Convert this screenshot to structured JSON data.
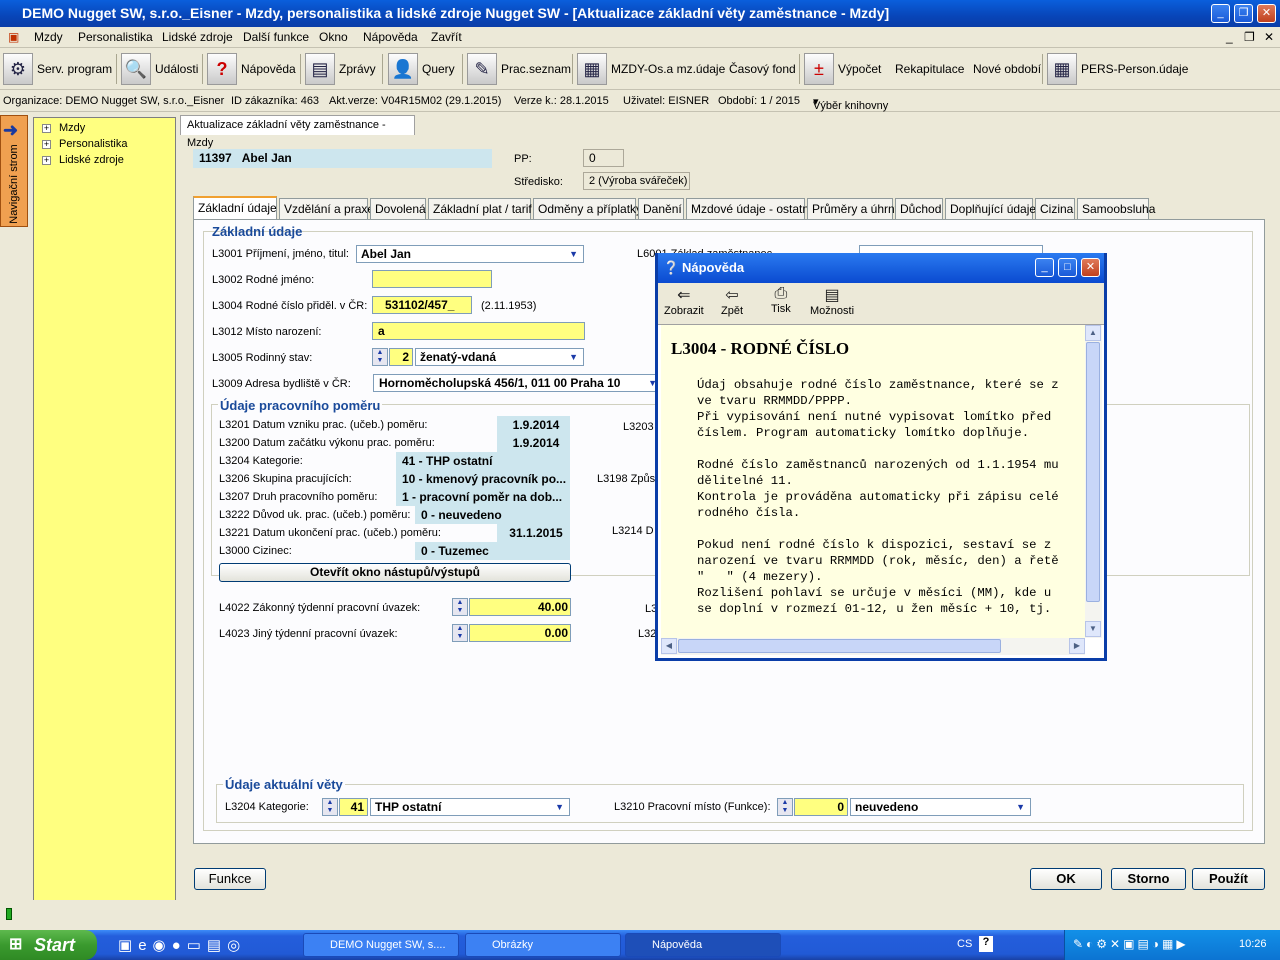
{
  "window": {
    "title": "DEMO Nugget SW, s.r.o._Eisner - Mzdy, personalistika a lidské zdroje Nugget SW - [Aktualizace základní věty zaměstnance - Mzdy]"
  },
  "menu": [
    "Mzdy",
    "Personalistika",
    "Lidské zdroje",
    "Další funkce",
    "Okno",
    "Nápověda",
    "Zavřít"
  ],
  "toolbar": [
    "Serv. program",
    "Události",
    "Nápověda",
    "Zprávy",
    "Query",
    "Prac.seznam",
    "MZDY-Os.a mz.údaje",
    "Časový fond",
    "Výpočet",
    "Rekapitulace",
    "Nové období",
    "PERS-Person.údaje"
  ],
  "info": {
    "org": "Organizace: DEMO Nugget SW, s.r.o._Eisner",
    "cid": "ID zákazníka: 463",
    "ver": "Akt.verze: V04R15M02 (29.1.2015)",
    "verk": "Verze k.: 28.1.2015",
    "user": "Uživatel: EISNER",
    "period": "Období: 1 / 2015",
    "lib": "Výběr knihovny"
  },
  "nav": {
    "strip": "Navigační strom",
    "items": [
      "Mzdy",
      "Personalistika",
      "Lidské zdroje"
    ]
  },
  "doc": {
    "tab": "Aktualizace základní věty zaměstnance - Mzdy"
  },
  "employee": {
    "id": "11397",
    "name": "Abel Jan",
    "pp_label": "PP:",
    "pp": "0",
    "stredisko_label": "Středisko:",
    "stredisko": "2 (Výroba svářeček)"
  },
  "tabs": [
    "Základní údaje",
    "Vzdělání a praxe",
    "Dovolená",
    "Základní plat / tarif",
    "Odměny a příplatky",
    "Danění",
    "Mzdové údaje - ostatní",
    "Průměry a úhrny",
    "Důchod",
    "Doplňující údaje",
    "Cizina",
    "Samoobsluha"
  ],
  "basic": {
    "section": "Základní údaje",
    "l3001": "L3001 Příjmení, jméno, titul:",
    "l3001_v": "Abel Jan",
    "l3002": "L3002 Rodné jméno:",
    "l3004": "L3004 Rodné číslo přiděl. v ČR:",
    "l3004_v": "531102/457_",
    "l3004_d": "(2.11.1953)",
    "l3012": "L3012 Místo narození:",
    "l3012_v": "a",
    "l3005": "L3005 Rodinný stav:",
    "l3005_n": "2",
    "l3005_v": "ženatý-vdaná",
    "l3009": "L3009 Adresa bydliště v ČR:",
    "l3009_v": "Hornoměcholupská 456/1, 011 00  Praha 10",
    "l6001": "L6001 Základ zaměstnanec"
  },
  "work": {
    "section": "Údaje pracovního poměru",
    "l3201": "L3201 Datum vzniku prac. (učeb.) poměru:",
    "l3201_v": "1.9.2014",
    "l3200": "L3200 Datum začátku výkonu prac. poměru:",
    "l3200_v": "1.9.2014",
    "l3204": "L3204 Kategorie:",
    "l3204_v": "41 - THP ostatní",
    "l3206": "L3206 Skupina pracujících:",
    "l3206_v": "10 - kmenový pracovník po...",
    "l3207": "L3207 Druh pracovního poměru:",
    "l3207_v": "1 - pracovní poměr na dob...",
    "l3222": "L3222 Důvod uk. prac. (učeb.) poměru:",
    "l3222_v": "0 - neuvedeno",
    "l3221": "L3221 Datum ukončení prac. (učeb.) poměru:",
    "l3221_v": "31.1.2015",
    "l3000": "L3000 Cizinec:",
    "l3000_v": "0 - Tuzemec",
    "open_btn": "Otevřít okno nástupů/výstupů",
    "l4022": "L4022 Zákonný týdenní pracovní úvazek:",
    "l4022_v": "40.00",
    "l4023": "L4023 Jiný týdenní pracovní úvazek:",
    "l4023_v": "0.00",
    "r1": "L3203",
    "r2": "L3198 Způs",
    "r3": "L3214 D",
    "r4": "L3",
    "r5": "L32"
  },
  "current": {
    "section": "Údaje aktuální věty",
    "l3204": "L3204 Kategorie:",
    "l3204_n": "41",
    "l3204_v": "THP ostatní",
    "l3210": "L3210 Pracovní místo (Funkce):",
    "l3210_n": "0",
    "l3210_v": "neuvedeno"
  },
  "buttons": {
    "funkce": "Funkce",
    "ok": "OK",
    "storno": "Storno",
    "pouzit": "Použít"
  },
  "help": {
    "title": "Nápověda",
    "tools": [
      "Zobrazit",
      "Zpět",
      "Tisk",
      "Možnosti"
    ],
    "heading": "L3004 - RODNÉ ČÍSLO",
    "body": "Údaj obsahuje rodné číslo zaměstnance, které se z\nve tvaru RRMMDD/PPPP.\nPři vypisování není nutné vypisovat lomítko před\nčíslem. Program automaticky lomítko doplňuje.\n\nRodné číslo zaměstnanců narozených od 1.1.1954 mu\ndělitelné 11.\nKontrola je prováděna automaticky při zápisu celé\nrodného čísla.\n\nPokud není rodné číslo k dispozici, sestaví se z\nnarození ve tvaru RRMMDD (rok, měsíc, den) a řetě\n\"   \" (4 mezery).\nRozlišení pohlaví se určuje v měsíci (MM), kde u\nse doplní v rozmezí 01-12, u žen měsíc + 10, tj."
  },
  "taskbar": {
    "start": "Start",
    "tasks": [
      "DEMO Nugget SW, s....",
      "Obrázky",
      "Nápověda"
    ],
    "lang": "CS",
    "time": "10:26"
  }
}
